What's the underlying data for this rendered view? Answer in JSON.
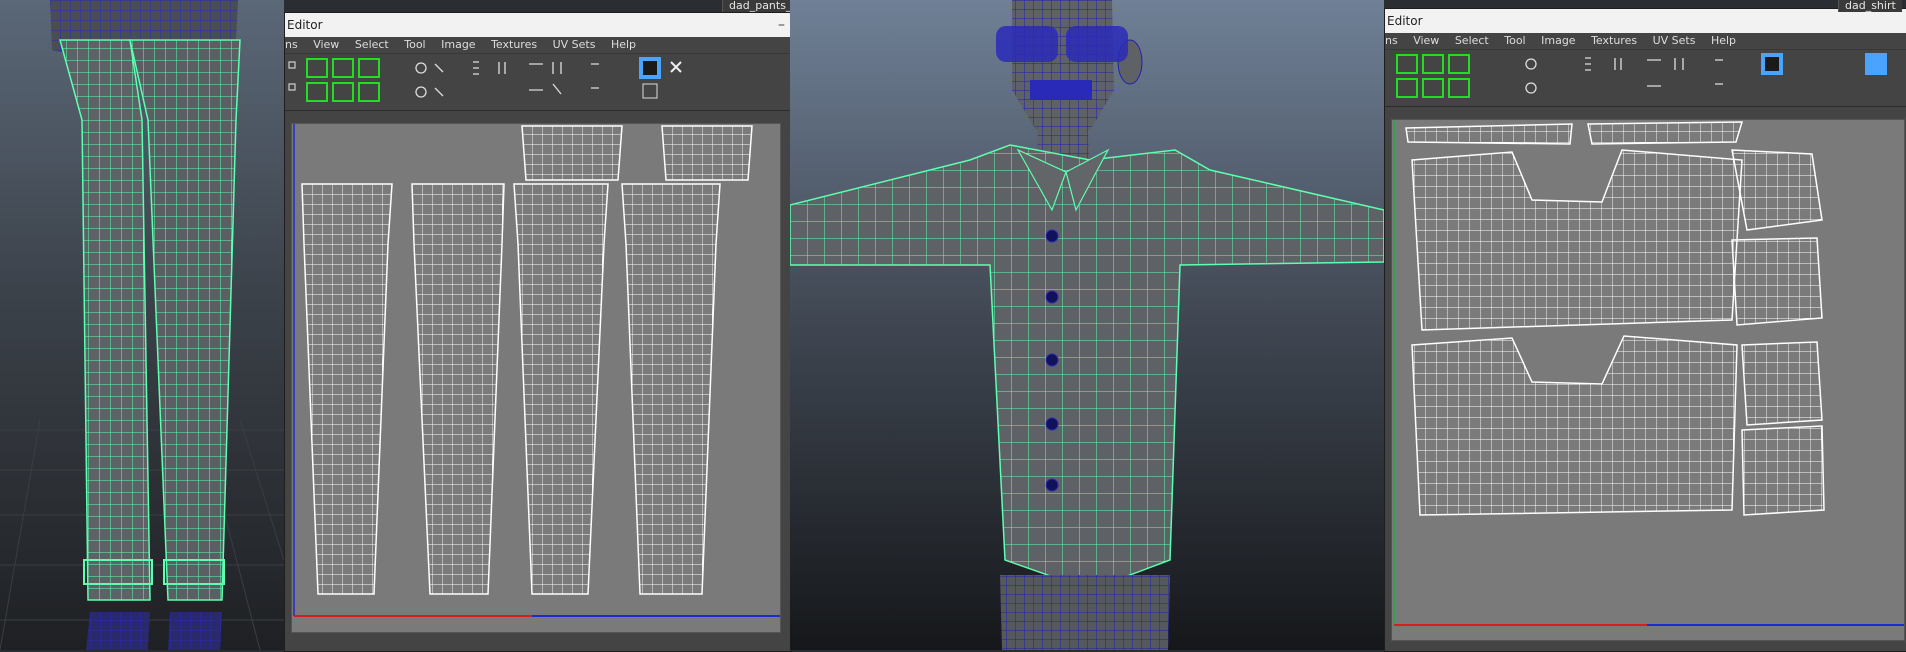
{
  "uv_editor_left": {
    "title": "Editor",
    "menus": [
      "ns",
      "View",
      "Select",
      "Tool",
      "Image",
      "Textures",
      "UV Sets",
      "Help"
    ],
    "tab_label": "dad_pants_c"
  },
  "uv_editor_right": {
    "title": "Editor",
    "menus": [
      "ns",
      "View",
      "Select",
      "Tool",
      "Image",
      "Textures",
      "UV Sets",
      "Help"
    ],
    "tab_label": "dad_shirt"
  },
  "icons": [
    "minimize-icon",
    "uv-tool-icon",
    "checker-icon",
    "grid-icon",
    "snap-icon"
  ],
  "colors": {
    "wire_green": "#5dffb0",
    "wire_blue": "#1d1da8",
    "model_grey": "#5e6166",
    "uv_bg": "#7a7a7a",
    "toolbar_bg": "#444444",
    "icon_green": "#22dd22",
    "icon_blue": "#4aa3ff"
  }
}
